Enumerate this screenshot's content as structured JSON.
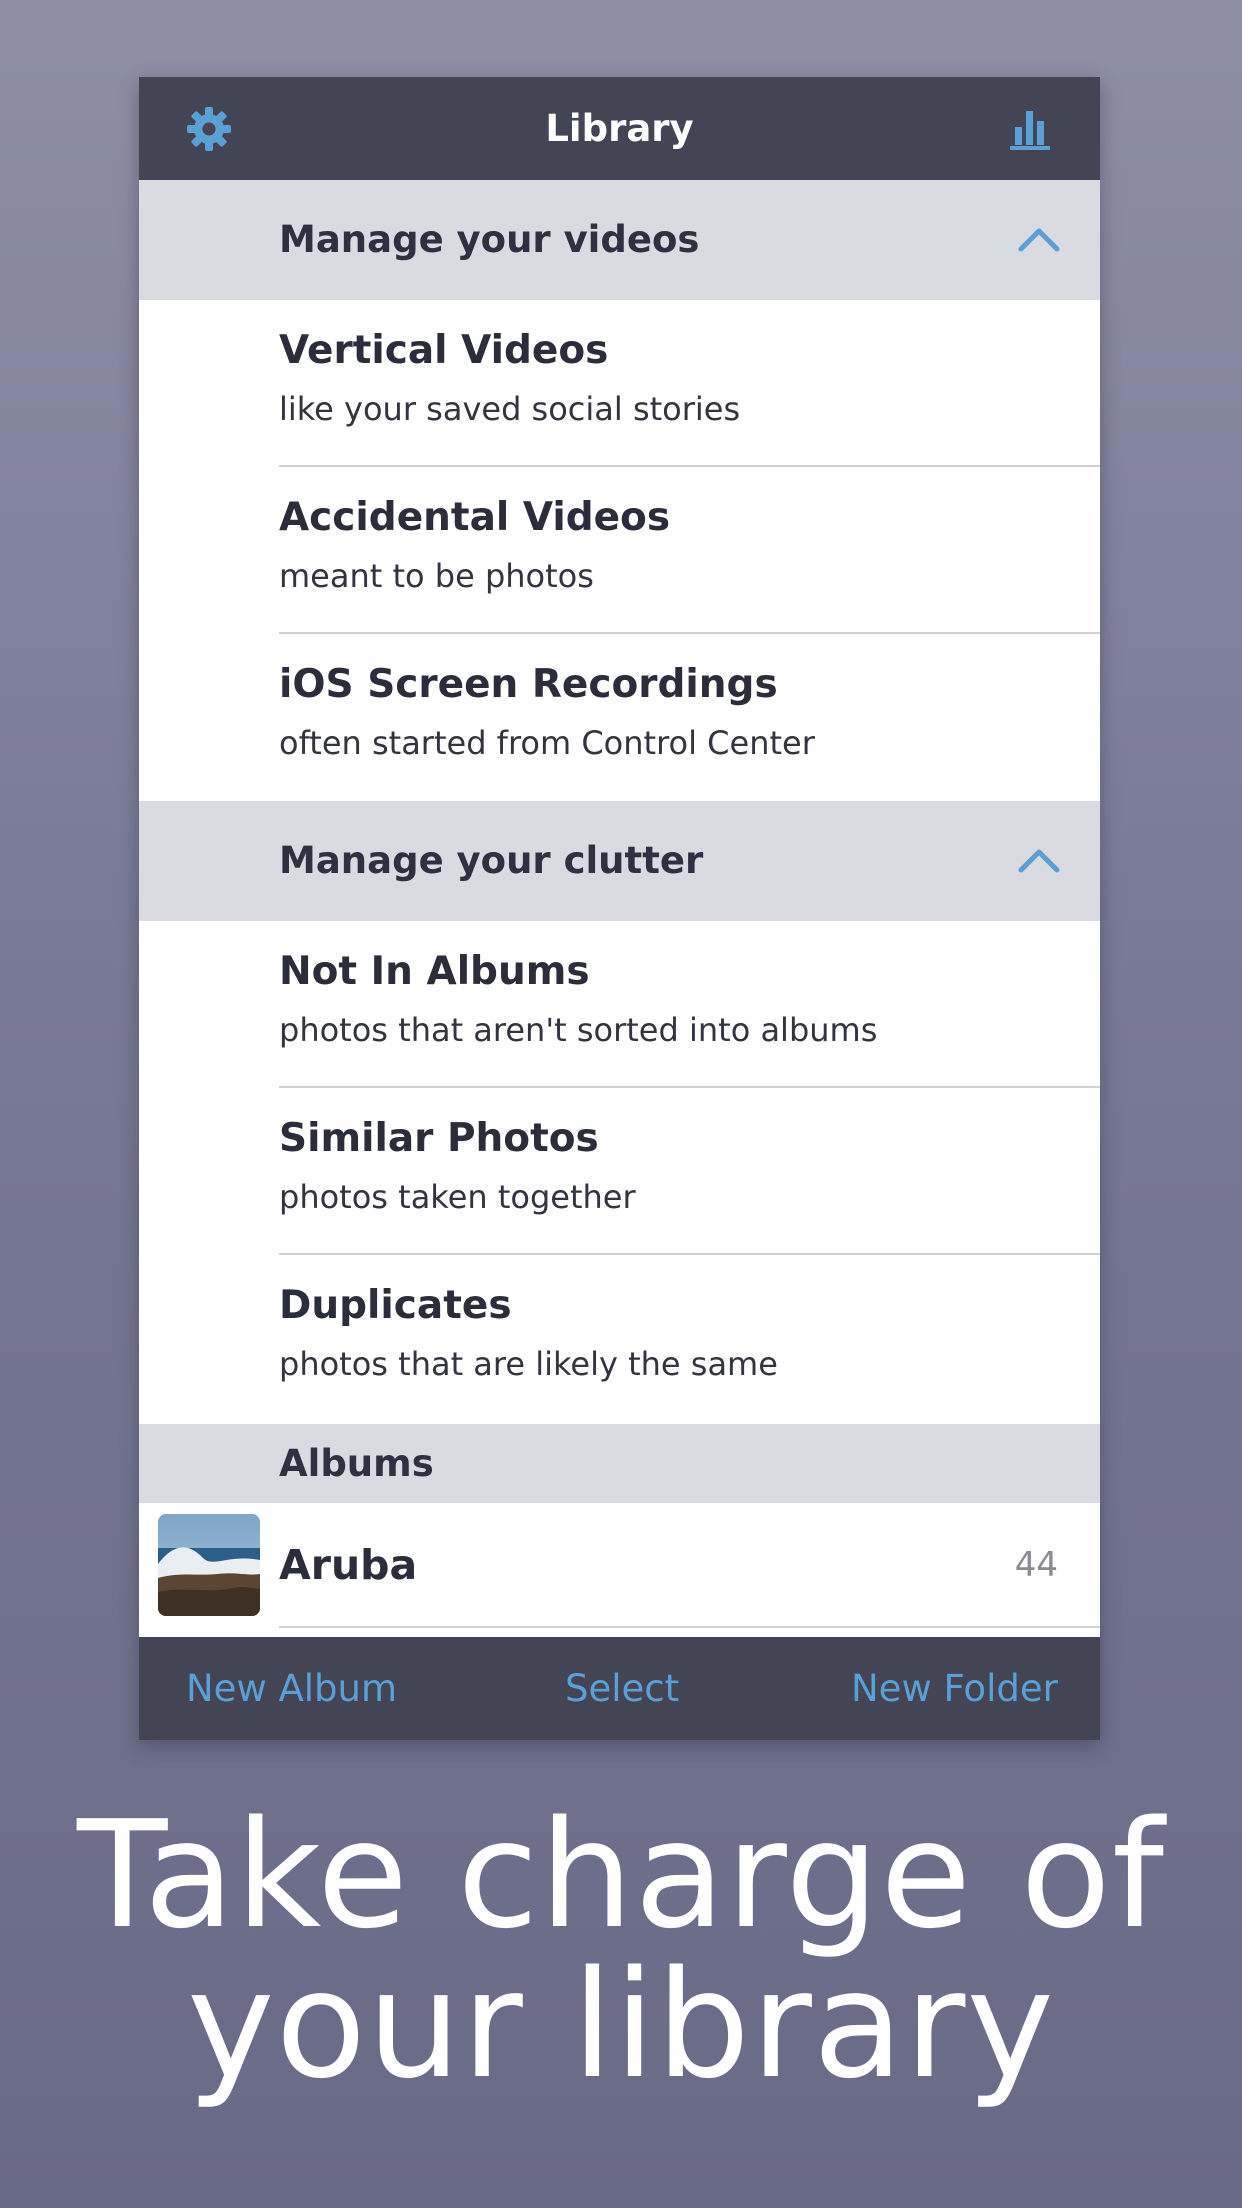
{
  "navbar": {
    "title": "Library",
    "left_icon": "gear-icon",
    "right_icon": "bar-chart-icon",
    "accent": "#5a9fd6"
  },
  "sections": [
    {
      "header": "Manage your videos",
      "icon": "chevron-up-icon",
      "items": [
        {
          "title": "Vertical Videos",
          "subtitle": "like your saved social stories"
        },
        {
          "title": "Accidental Videos",
          "subtitle": "meant to be photos"
        },
        {
          "title": "iOS Screen Recordings",
          "subtitle": "often started from Control Center"
        }
      ]
    },
    {
      "header": "Manage your clutter",
      "icon": "chevron-up-icon",
      "items": [
        {
          "title": "Not In Albums",
          "subtitle": "photos that aren't sorted into albums"
        },
        {
          "title": "Similar Photos",
          "subtitle": "photos taken together"
        },
        {
          "title": "Duplicates",
          "subtitle": "photos that are likely the same"
        }
      ]
    }
  ],
  "albums": {
    "header": "Albums",
    "items": [
      {
        "name": "Aruba",
        "count": "44",
        "thumb_icon": "album-thumbnail"
      }
    ]
  },
  "toolbar": {
    "new_album": "New Album",
    "select": "Select",
    "new_folder": "New Folder"
  },
  "tagline": {
    "line1": "Take charge of",
    "line2": "your library"
  }
}
